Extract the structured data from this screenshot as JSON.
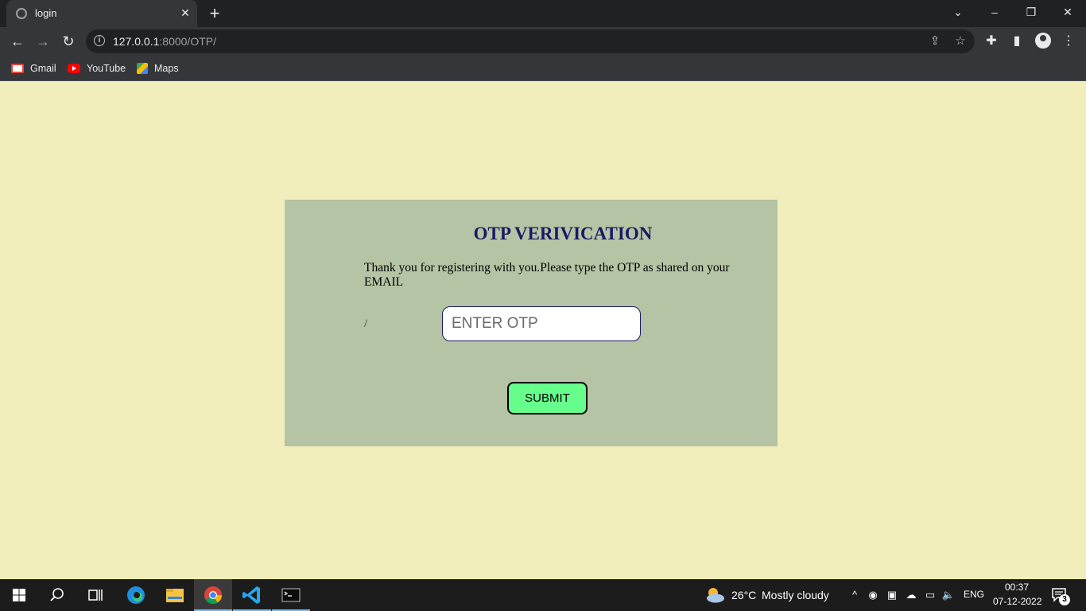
{
  "browser": {
    "tab_title": "login",
    "tab_close": "✕",
    "new_tab": "+",
    "url_host": "127.0.0.1",
    "url_rest": ":8000/OTP/",
    "window_controls": {
      "dropdown": "⌄",
      "minimize": "–",
      "restore": "❐",
      "close": "✕"
    },
    "nav": {
      "back": "←",
      "forward": "→",
      "reload": "↻",
      "info": "i"
    },
    "omnibox_icons": {
      "share": "⇪",
      "bookmark": "☆"
    },
    "toolbar_icons": {
      "extensions": "✚",
      "side_panel": "▮",
      "menu": "⋮"
    },
    "bookmarks": [
      {
        "label": "Gmail",
        "icon": "gmail-icon"
      },
      {
        "label": "YouTube",
        "icon": "youtube-icon"
      },
      {
        "label": "Maps",
        "icon": "maps-icon"
      }
    ]
  },
  "page": {
    "heading": "OTP VERIVICATION",
    "message": "Thank you for registering with you.Please type the OTP as shared on your EMAIL",
    "stray_text": "/",
    "otp_placeholder": "ENTER OTP",
    "submit_label": "SUBMIT",
    "colors": {
      "background": "#f2eebb",
      "card": "#b5c4a4",
      "heading": "#1a1a66",
      "button": "#66ff8c"
    }
  },
  "taskbar": {
    "weather_temp": "26°C",
    "weather_desc": "Mostly cloudy",
    "language": "ENG",
    "time": "00:37",
    "date": "07-12-2022",
    "notification_count": "3",
    "tray_icons": {
      "chevron": "^",
      "record": "◉",
      "meet": "▣",
      "cloud": "☁",
      "battery": "▭",
      "volume": "🔈"
    },
    "apps": [
      "start-icon",
      "search-icon",
      "task-view-icon",
      "edge-icon",
      "file-explorer-icon",
      "chrome-icon",
      "vscode-icon",
      "terminal-icon"
    ]
  }
}
